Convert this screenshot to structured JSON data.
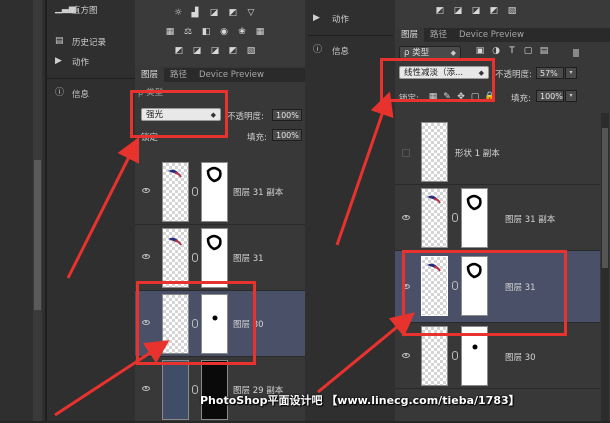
{
  "left_dock": {
    "items": [
      {
        "label": "直方图",
        "icon": "histogram-icon"
      },
      {
        "label": "历史记录",
        "icon": "history-icon"
      },
      {
        "label": "动作",
        "icon": "play-icon"
      },
      {
        "label": "信息",
        "icon": "info-icon"
      }
    ]
  },
  "middle_panel": {
    "tabs": [
      "图层",
      "路径",
      "Device Preview"
    ],
    "blend_mode": "强光",
    "kind_label": "类型",
    "opacity_label": "不透明度:",
    "opacity_value": "100%",
    "lock_label": "锁定",
    "fill_label": "填充:",
    "fill_value": "100%",
    "layers": [
      {
        "name": "图层 31 副本"
      },
      {
        "name": "图层 31"
      },
      {
        "name": "图层 30"
      },
      {
        "name": "图层 29 副本"
      }
    ]
  },
  "right_dock": {
    "items": [
      {
        "label": "动作",
        "icon": "play-icon"
      },
      {
        "label": "信息",
        "icon": "info-icon"
      }
    ]
  },
  "right_panel": {
    "tabs": [
      "图层",
      "路径",
      "Device Preview"
    ],
    "kind_label": "类型",
    "blend_mode": "线性减淡（添...",
    "opacity_label": "不透明度:",
    "opacity_value": "57%",
    "lock_label": "锁定:",
    "fill_label": "填充:",
    "fill_value": "100%",
    "layers": [
      {
        "name": "形状 1 副本"
      },
      {
        "name": "图层 31 副本"
      },
      {
        "name": "图层 31"
      },
      {
        "name": "图层 30"
      }
    ]
  },
  "watermark": "PhotoShop平面设计吧 【www.linecg.com/tieba/1783】",
  "colors": {
    "annotation_red": "#e8322e",
    "selected_layer": "#4a5068",
    "panel_bg": "#383838"
  }
}
